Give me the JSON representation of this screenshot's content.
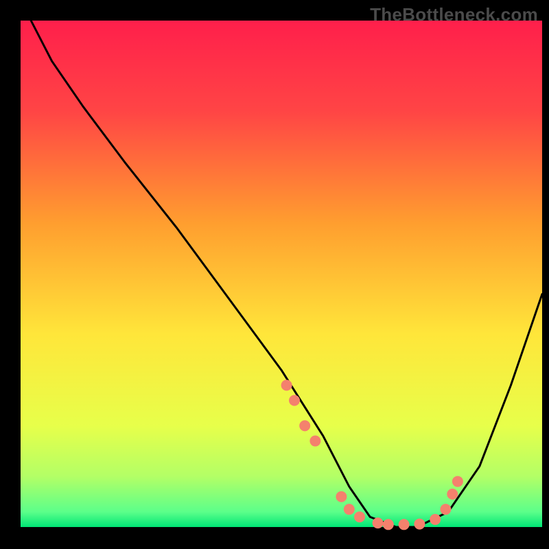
{
  "watermark": "TheBottleneck.com",
  "chart_data": {
    "type": "line",
    "title": "",
    "xlabel": "",
    "ylabel": "",
    "xlim": [
      0,
      100
    ],
    "ylim": [
      0,
      100
    ],
    "gradient_stops": [
      {
        "offset": 0,
        "color": "#ff1f4b"
      },
      {
        "offset": 18,
        "color": "#ff4545"
      },
      {
        "offset": 40,
        "color": "#ff9e2f"
      },
      {
        "offset": 62,
        "color": "#ffe63a"
      },
      {
        "offset": 80,
        "color": "#e7ff4a"
      },
      {
        "offset": 90,
        "color": "#b3ff66"
      },
      {
        "offset": 97,
        "color": "#5cff8a"
      },
      {
        "offset": 100,
        "color": "#00e676"
      }
    ],
    "series": [
      {
        "name": "bottleneck-curve",
        "x": [
          2,
          6,
          12,
          20,
          30,
          40,
          50,
          58,
          63,
          67,
          72,
          76,
          82,
          88,
          94,
          100
        ],
        "y": [
          100,
          92,
          83,
          72,
          59,
          45,
          31,
          18,
          8,
          2,
          0,
          0,
          3,
          12,
          28,
          46
        ]
      }
    ],
    "scatter": {
      "name": "marker-dots",
      "color": "#f4816d",
      "x": [
        51.0,
        52.5,
        54.5,
        56.5,
        61.5,
        63.0,
        65.0,
        68.5,
        70.5,
        73.5,
        76.5,
        79.5,
        81.5,
        82.8,
        83.8
      ],
      "y": [
        28.0,
        25.0,
        20.0,
        17.0,
        6.0,
        3.5,
        2.0,
        0.8,
        0.5,
        0.5,
        0.6,
        1.5,
        3.5,
        6.5,
        9.0
      ]
    }
  }
}
